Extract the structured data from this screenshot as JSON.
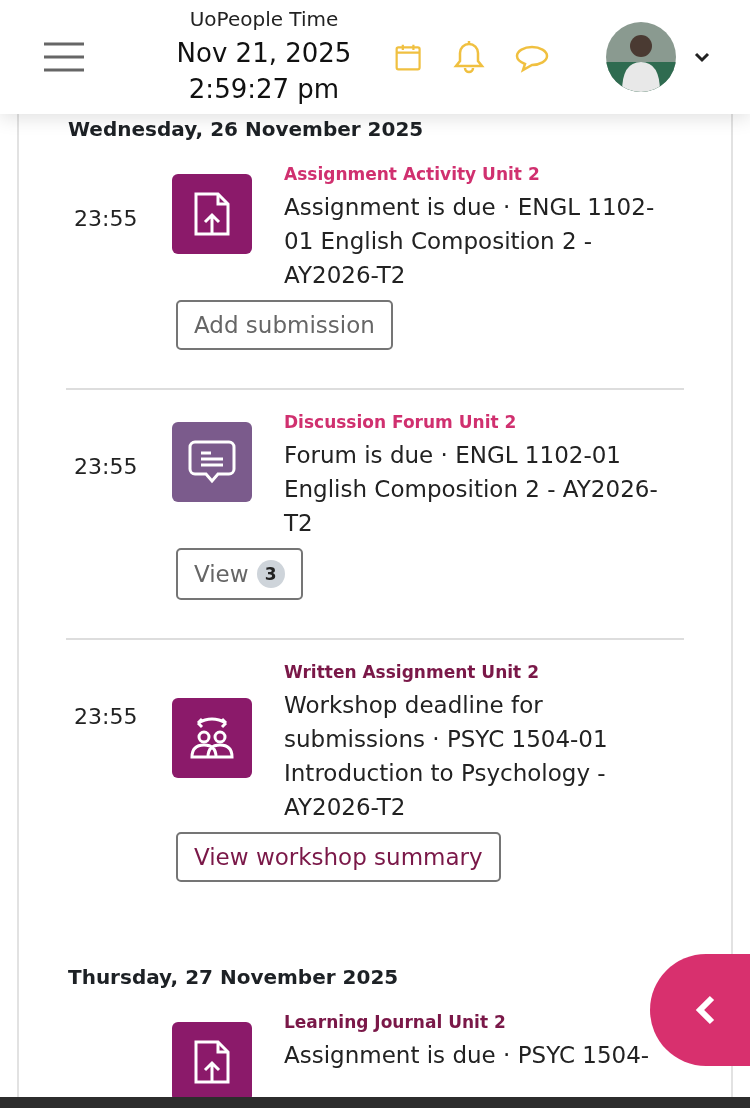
{
  "header": {
    "clock_label": "UoPeople Time",
    "date": "Nov 21, 2025",
    "time": "2:59:27 pm"
  },
  "days": [
    {
      "heading": "Wednesday, 26 November 2025",
      "events": [
        {
          "time": "23:55",
          "kind": "assignment",
          "category": "Assignment Activity Unit 2",
          "color": "#d0306f",
          "description": "Assignment is due · ENGL 1102-01 English Composition 2 - AY2026-T2",
          "action": {
            "label": "Add submission",
            "kind": "plain"
          }
        },
        {
          "time": "23:55",
          "kind": "forum",
          "category": "Discussion Forum Unit 2",
          "color": "#d0306f",
          "description": "Forum is due · ENGL 1102-01 English Composition 2 - AY2026-T2",
          "action": {
            "label": "View",
            "count": "3",
            "kind": "plain"
          }
        },
        {
          "time": "23:55",
          "kind": "workshop",
          "category": "Written Assignment Unit 2",
          "color": "#7a1848",
          "description": "Workshop deadline for submissions · PSYC 1504-01 Introduction to Psychology - AY2026-T2",
          "action": {
            "label": "View workshop summary",
            "kind": "accent"
          }
        }
      ]
    },
    {
      "heading": "Thursday, 27 November 2025",
      "events": [
        {
          "kind": "assignment",
          "category": "Learning Journal Unit 2",
          "color": "#7a1848",
          "description": "Assignment is due · PSYC 1504-"
        }
      ]
    }
  ]
}
